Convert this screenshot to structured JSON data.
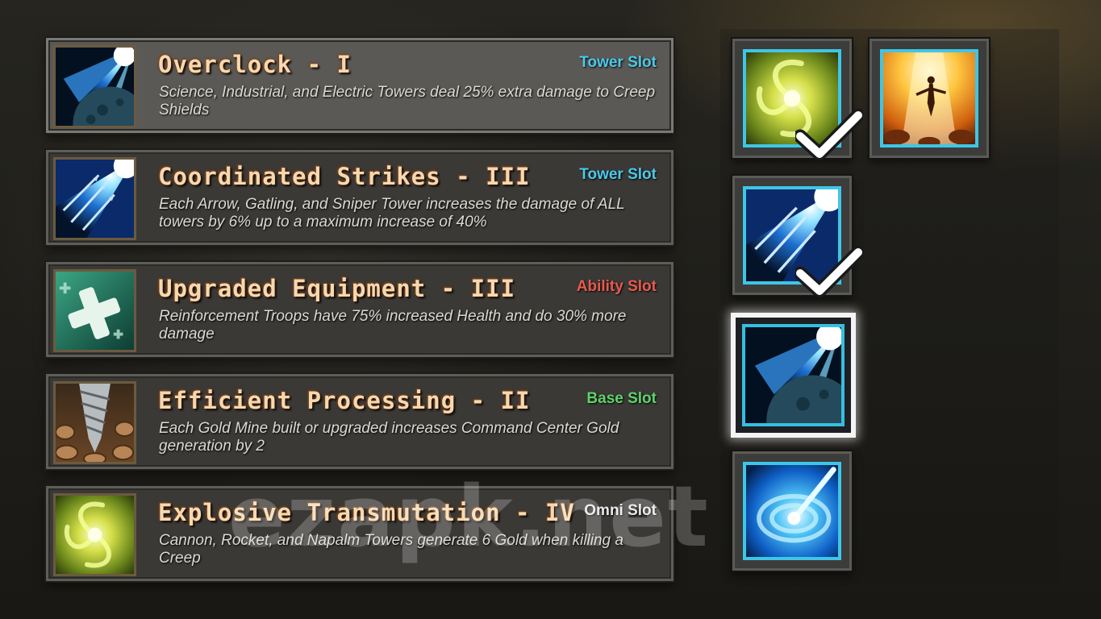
{
  "upgrades": [
    {
      "title": "Overclock - I",
      "slot": "Tower Slot",
      "slot_color": "#4cc9ea",
      "description": "Science, Industrial, and Electric Towers deal 25% extra damage to Creep Shields",
      "icon": "planet-blast-icon",
      "selected": true
    },
    {
      "title": "Coordinated Strikes - III",
      "slot": "Tower Slot",
      "slot_color": "#4cc9ea",
      "description": "Each Arrow, Gatling, and Sniper Tower increases the damage of ALL towers by 6% up to a maximum increase of 40%",
      "icon": "arrow-volley-icon",
      "selected": false
    },
    {
      "title": "Upgraded Equipment - III",
      "slot": "Ability Slot",
      "slot_color": "#e85a4f",
      "description": "Reinforcement Troops have 75% increased Health and do 30% more damage",
      "icon": "medical-cross-icon",
      "selected": false
    },
    {
      "title": "Efficient Processing - II",
      "slot": "Base Slot",
      "slot_color": "#5fd46a",
      "description": "Each Gold Mine built or upgraded increases Command Center Gold generation by 2",
      "icon": "drill-icon",
      "selected": false
    },
    {
      "title": "Explosive Transmutation - IV",
      "slot": "Omni Slot",
      "slot_color": "#e8e8e8",
      "description": "Cannon, Rocket, and Napalm Towers generate 6 Gold when killing a Creep",
      "icon": "yellow-swirl-icon",
      "selected": false
    }
  ],
  "equipped_slots": [
    {
      "icon": "yellow-swirl-icon",
      "checked": true
    },
    {
      "icon": "light-beam-icon",
      "checked": false
    },
    {
      "icon": "arrow-volley-icon",
      "checked": true
    },
    {
      "icon": "planet-blast-icon",
      "checked": false,
      "active": true
    },
    {
      "icon": "blue-vortex-icon",
      "checked": false
    }
  ],
  "watermark": "ezapk.net"
}
